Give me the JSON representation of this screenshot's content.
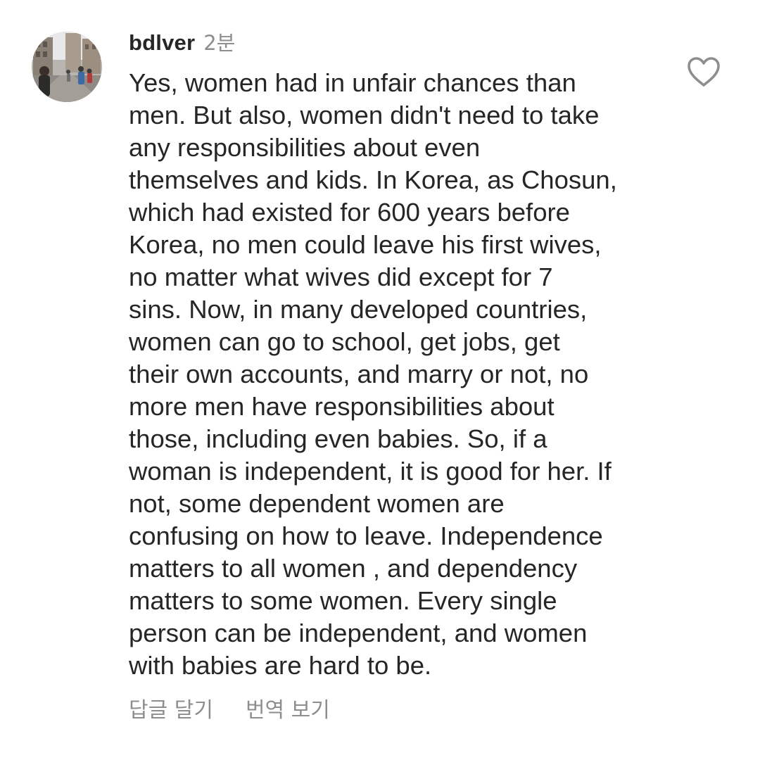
{
  "comment": {
    "username": "bdlver",
    "time": "2분",
    "lines": [
      "Yes, women had in unfair chances than",
      "men. But also, women didn't need to take",
      "any responsibilities about even",
      "themselves and kids. In Korea, as Chosun,",
      "which had existed for 600 years before",
      "Korea, no men could leave his first wives,",
      "no matter what wives did except for 7",
      "sins. Now, in many developed countries,",
      "women can go to school, get jobs, get",
      "their own accounts, and marry or not, no",
      "more men have responsibilities about",
      "those, including even babies. So, if a",
      "woman is independent, it is good for her. If",
      "not, some dependent women are",
      "confusing on how to leave. Independence",
      "matters to all women , and dependency",
      "matters to some women. Every single",
      "person can be independent, and women",
      "with babies are hard to be."
    ],
    "actions": {
      "reply": "답글 달기",
      "translate": "번역 보기"
    },
    "like_icon": "heart-outline-icon"
  },
  "colors": {
    "text": "#262626",
    "secondary": "#8e8e8e",
    "background": "#ffffff"
  }
}
